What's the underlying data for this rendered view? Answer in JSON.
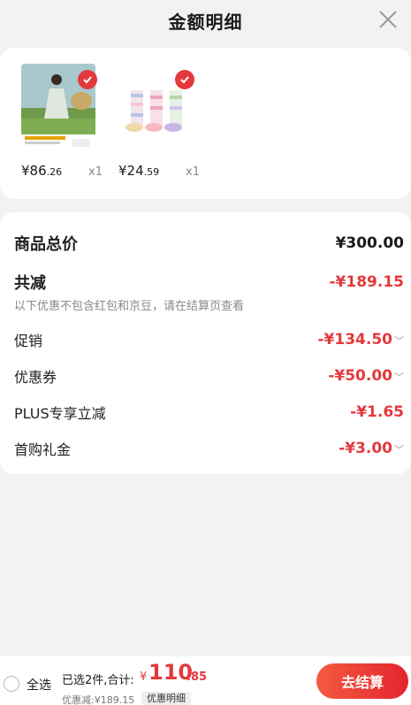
{
  "header": {
    "title": "金额明细"
  },
  "products": [
    {
      "price_int": "¥86",
      "price_dec": ".26",
      "qty": "x1",
      "thumb": "dress-photo"
    },
    {
      "price_int": "¥24",
      "price_dec": ".59",
      "qty": "x1",
      "thumb": "socks-photo"
    }
  ],
  "summary": {
    "total_label": "商品总价",
    "total_value": "¥300.00",
    "reduce_label": "共减",
    "reduce_value": "-¥189.15",
    "note": "以下优惠不包含红包和京豆，请在结算页查看",
    "items": [
      {
        "label": "促销",
        "value": "-¥134.50",
        "expandable": true
      },
      {
        "label": "优惠券",
        "value": "-¥50.00",
        "expandable": true
      },
      {
        "label": "PLUS专享立减",
        "value": "-¥1.65",
        "expandable": false
      },
      {
        "label": "首购礼金",
        "value": "-¥3.00",
        "expandable": true
      }
    ]
  },
  "bottom": {
    "select_all": "全选",
    "count_text": "已选2件,合计:",
    "currency": "¥",
    "total_int": "110",
    "total_dec": ".85",
    "saved_text": "优惠减:¥189.15",
    "detail_tag": "优惠明细",
    "checkout": "去结算"
  },
  "colors": {
    "accent": "#e4393c"
  }
}
